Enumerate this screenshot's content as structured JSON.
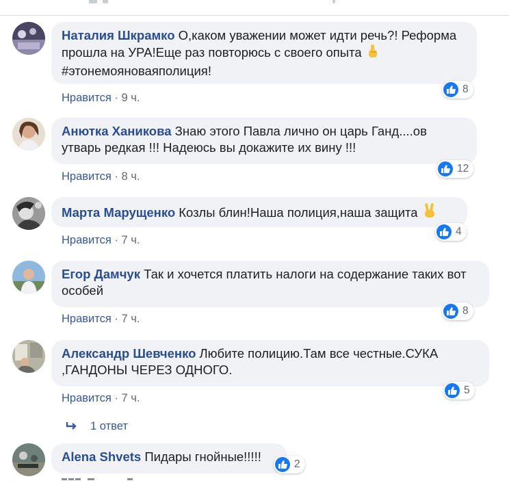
{
  "icons": {
    "like": "thumbs-up-icon",
    "reply_arrow": "reply-arrow-icon",
    "point_up": "index-pointing-up-emoji",
    "victory": "victory-hand-emoji"
  },
  "colors": {
    "author": "#2a4d8f",
    "link": "#365899",
    "like_badge": "#1877f2",
    "bubble": "#f0f2f5",
    "meta": "#606770"
  },
  "comments": [
    {
      "author": "Наталия Шкрамко",
      "text": " О,каком уважении может идти речь?! Реформа прошла на УРА!Еще раз повторюсь с своего опыта",
      "text_tail": "#этонемояноваяполиция!",
      "like_label": "Нравится",
      "time": " · 9 ч.",
      "likes": "8"
    },
    {
      "author": "Анютка Ханикова",
      "text": " Знаю этого Павла лично он царь Ганд....ов утварь редкая !!! Надеюсь вы докажите их вину !!!",
      "like_label": "Нравится",
      "time": " · 8 ч.",
      "likes": "12"
    },
    {
      "author": "Марта Марущенко",
      "text": " Козлы блин!Наша полиция,наша защита",
      "like_label": "Нравится",
      "time": " · 7 ч.",
      "likes": "4"
    },
    {
      "author": "Егор Дамчук",
      "text": " Так и хочется платить налоги на содержание таких вот особей",
      "like_label": "Нравится",
      "time": " · 7 ч.",
      "likes": "8"
    },
    {
      "author": "Александр Шевченко",
      "text": " Любите полицию.Там все честные.СУКА ,ГАНДОНЫ ЧЕРЕЗ ОДНОГО.",
      "like_label": "Нравится",
      "time": " · 7 ч.",
      "likes": "5"
    },
    {
      "author": "Alena Shvets",
      "text": " Пидары гнойные!!!!!",
      "likes": "2"
    }
  ],
  "replies": {
    "label": "1 ответ"
  }
}
